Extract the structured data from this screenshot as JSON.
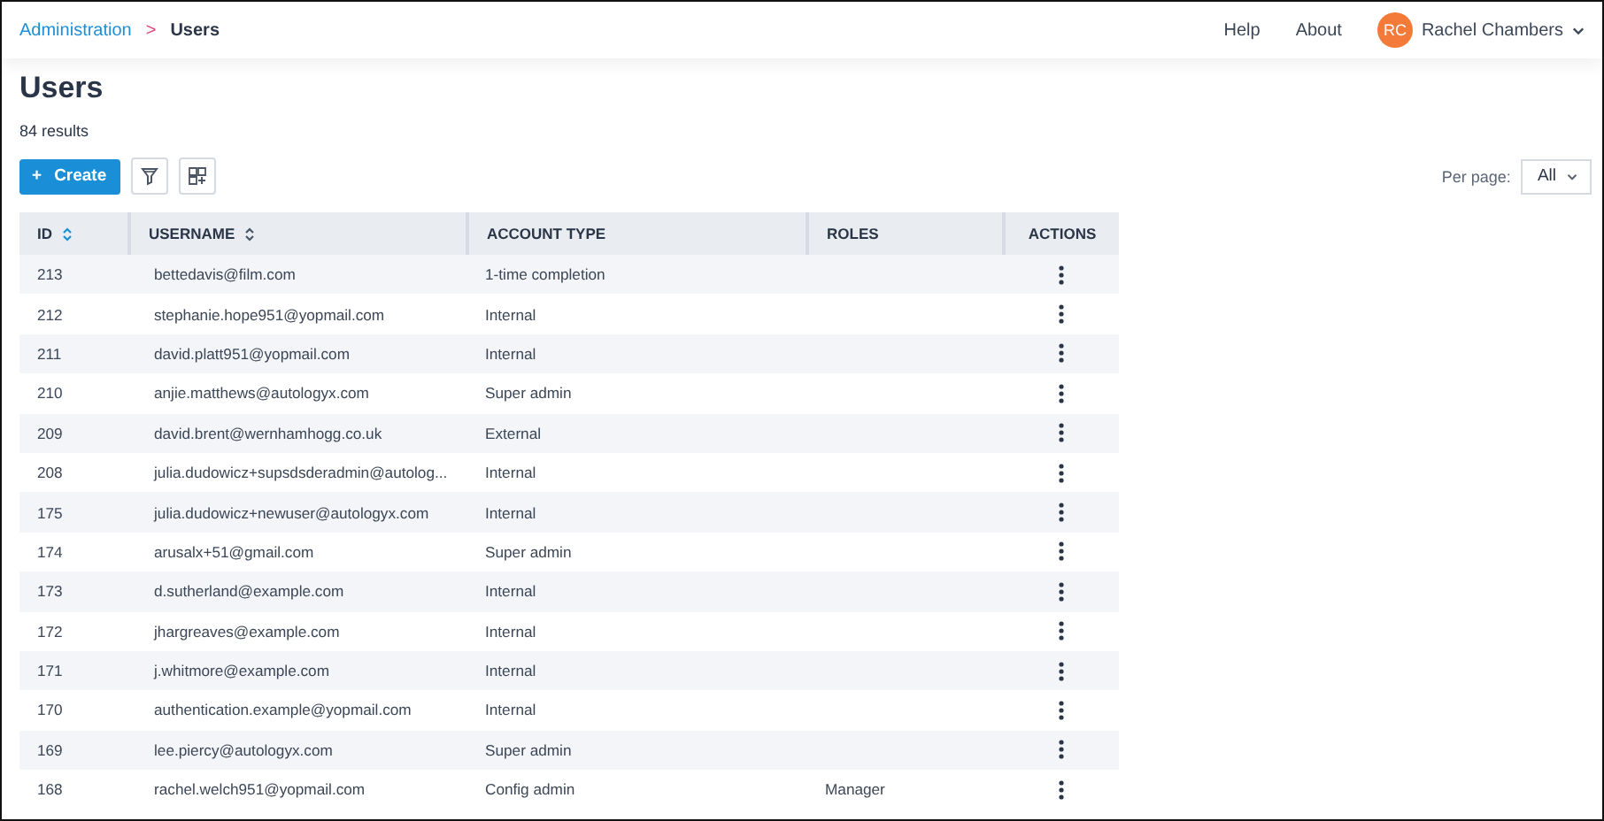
{
  "breadcrumb": [
    {
      "label": "Administration",
      "current": false
    },
    {
      "label": "Users",
      "current": true
    }
  ],
  "separator": ">",
  "header_links": [
    "Help",
    "About"
  ],
  "user": {
    "initials": "RC",
    "name": "Rachel Chambers"
  },
  "page": {
    "title": "Users",
    "results": "84 results"
  },
  "toolbar": {
    "create": "Create",
    "create_icon": "+",
    "per_page_label": "Per page:",
    "per_page_value": "All"
  },
  "table": {
    "columns": [
      {
        "label": "ID",
        "sorted": true
      },
      {
        "label": "USERNAME",
        "sorted": false
      },
      {
        "label": "ACCOUNT TYPE"
      },
      {
        "label": "ROLES"
      },
      {
        "label": "ACTIONS"
      }
    ],
    "rows": [
      {
        "id": "213",
        "username": "bettedavis@film.com",
        "account_type": "1-time completion"
      },
      {
        "id": "212",
        "username": "stephanie.hope951@yopmail.com",
        "account_type": "Internal"
      },
      {
        "id": "211",
        "username": "david.platt951@yopmail.com",
        "account_type": "Internal"
      },
      {
        "id": "210",
        "username": "anjie.matthews@autologyx.com",
        "account_type": "Super admin"
      },
      {
        "id": "209",
        "username": "david.brent@wernhamhogg.co.uk",
        "account_type": "External"
      },
      {
        "id": "208",
        "username": "julia.dudowicz+supsdsderadmin@autolog...",
        "account_type": "Internal"
      },
      {
        "id": "175",
        "username": "julia.dudowicz+newuser@autologyx.com",
        "account_type": "Internal"
      },
      {
        "id": "174",
        "username": "arusalx+51@gmail.com",
        "account_type": "Super admin"
      },
      {
        "id": "173",
        "username": "d.sutherland@example.com",
        "account_type": "Internal"
      },
      {
        "id": "172",
        "username": "jhargreaves@example.com",
        "account_type": "Internal"
      },
      {
        "id": "171",
        "username": "j.whitmore@example.com",
        "account_type": "Internal"
      },
      {
        "id": "170",
        "username": "authentication.example@yopmail.com",
        "account_type": "Internal"
      },
      {
        "id": "169",
        "username": "lee.piercy@autologyx.com",
        "account_type": "Super admin"
      },
      {
        "id": "168",
        "username": "rachel.welch951@yopmail.com",
        "account_type": "Config admin",
        "roles": "Manager"
      }
    ]
  }
}
